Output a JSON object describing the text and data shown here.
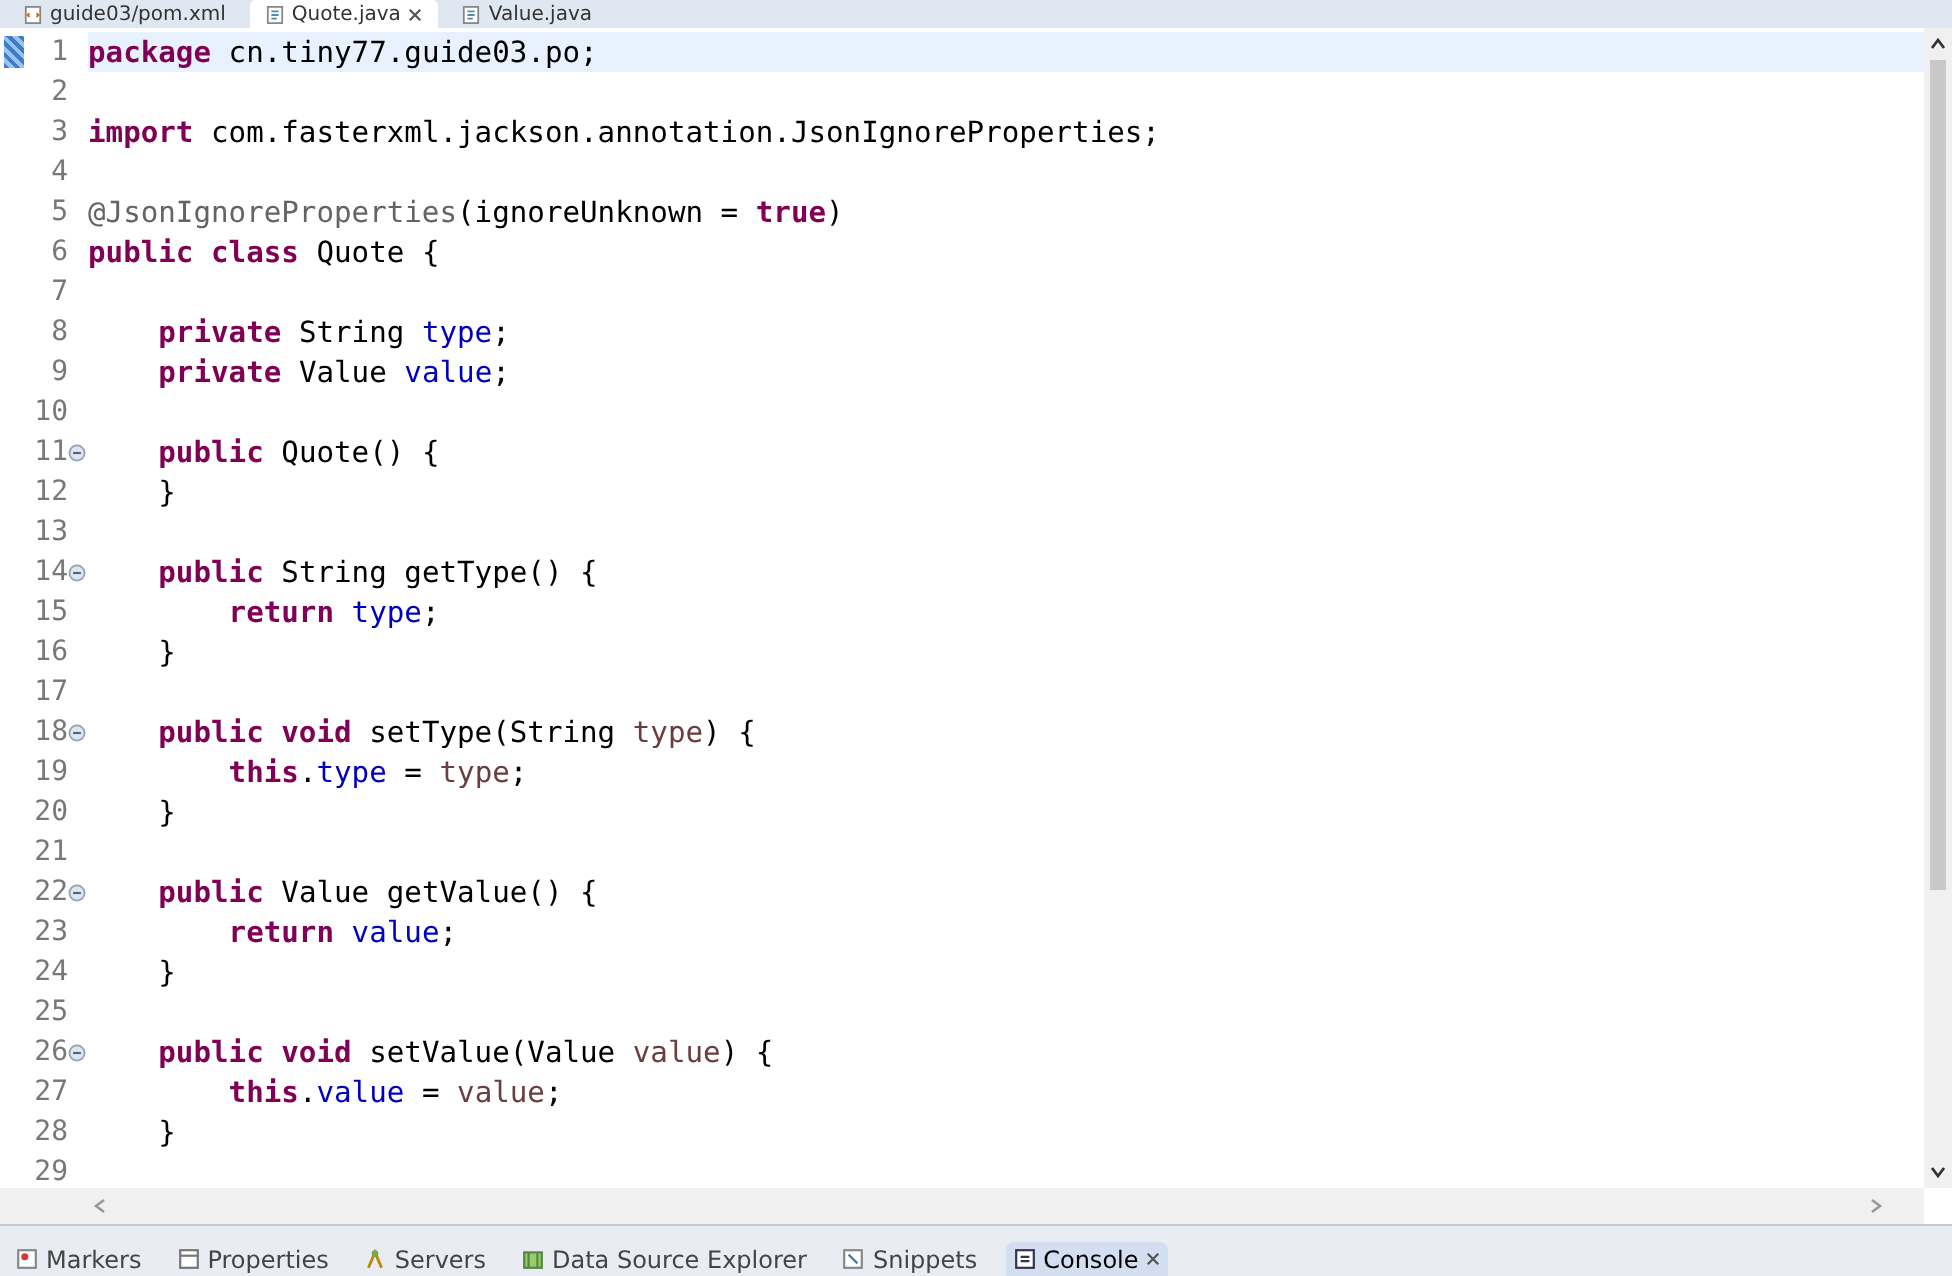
{
  "editor_tabs": [
    {
      "label": "guide03/pom.xml",
      "selected": false
    },
    {
      "label": "Quote.java",
      "selected": true
    },
    {
      "label": "Value.java",
      "selected": false
    }
  ],
  "lines": [
    {
      "number": "1",
      "fold": false,
      "current": true,
      "tokens": [
        {
          "kind": "keyword",
          "text": "package"
        },
        {
          "kind": "plain",
          "text": " cn.tiny77.guide03.po;"
        }
      ]
    },
    {
      "number": "2",
      "fold": false,
      "current": false
    },
    {
      "number": "3",
      "fold": false,
      "current": false,
      "tokens": [
        {
          "kind": "keyword",
          "text": "import"
        },
        {
          "kind": "plain",
          "text": " com.fasterxml.jackson.annotation.JsonIgnoreProperties;"
        }
      ]
    },
    {
      "number": "4",
      "fold": false,
      "current": false
    },
    {
      "number": "5",
      "fold": false,
      "current": false,
      "tokens": [
        {
          "kind": "annotation",
          "text": "@JsonIgnoreProperties"
        },
        {
          "kind": "plain",
          "text": "(ignoreUnknown = "
        },
        {
          "kind": "keyword",
          "text": "true"
        },
        {
          "kind": "plain",
          "text": ")"
        }
      ]
    },
    {
      "number": "6",
      "fold": false,
      "current": false,
      "tokens": [
        {
          "kind": "keyword",
          "text": "public class"
        },
        {
          "kind": "plain",
          "text": " Quote {"
        }
      ]
    },
    {
      "number": "7",
      "fold": false,
      "current": false
    },
    {
      "number": "8",
      "fold": false,
      "current": false,
      "tokens": [
        {
          "kind": "keyword",
          "text": "    private"
        },
        {
          "kind": "plain",
          "text": " String "
        },
        {
          "kind": "field",
          "text": "type"
        },
        {
          "kind": "plain",
          "text": ";"
        }
      ]
    },
    {
      "number": "9",
      "fold": false,
      "current": false,
      "tokens": [
        {
          "kind": "keyword",
          "text": "    private"
        },
        {
          "kind": "plain",
          "text": " Value "
        },
        {
          "kind": "field",
          "text": "value"
        },
        {
          "kind": "plain",
          "text": ";"
        }
      ]
    },
    {
      "number": "10",
      "fold": false,
      "current": false
    },
    {
      "number": "11",
      "fold": true,
      "current": false,
      "tokens": [
        {
          "kind": "keyword",
          "text": "    public"
        },
        {
          "kind": "plain",
          "text": " Quote() {"
        }
      ]
    },
    {
      "number": "12",
      "fold": false,
      "current": false,
      "tokens": [
        {
          "kind": "plain",
          "text": "    }"
        }
      ]
    },
    {
      "number": "13",
      "fold": false,
      "current": false
    },
    {
      "number": "14",
      "fold": true,
      "current": false,
      "tokens": [
        {
          "kind": "keyword",
          "text": "    public"
        },
        {
          "kind": "plain",
          "text": " String getType() {"
        }
      ]
    },
    {
      "number": "15",
      "fold": false,
      "current": false,
      "tokens": [
        {
          "kind": "keyword",
          "text": "        return "
        },
        {
          "kind": "field",
          "text": "type"
        },
        {
          "kind": "plain",
          "text": ";"
        }
      ]
    },
    {
      "number": "16",
      "fold": false,
      "current": false,
      "tokens": [
        {
          "kind": "plain",
          "text": "    }"
        }
      ]
    },
    {
      "number": "17",
      "fold": false,
      "current": false
    },
    {
      "number": "18",
      "fold": true,
      "current": false,
      "tokens": [
        {
          "kind": "keyword",
          "text": "    public void"
        },
        {
          "kind": "plain",
          "text": " setType(String "
        },
        {
          "kind": "parameter",
          "text": "type"
        },
        {
          "kind": "plain",
          "text": ") {"
        }
      ]
    },
    {
      "number": "19",
      "fold": false,
      "current": false,
      "tokens": [
        {
          "kind": "keyword",
          "text": "        this"
        },
        {
          "kind": "plain",
          "text": "."
        },
        {
          "kind": "field",
          "text": "type"
        },
        {
          "kind": "plain",
          "text": " = "
        },
        {
          "kind": "parameter",
          "text": "type"
        },
        {
          "kind": "plain",
          "text": ";"
        }
      ]
    },
    {
      "number": "20",
      "fold": false,
      "current": false,
      "tokens": [
        {
          "kind": "plain",
          "text": "    }"
        }
      ]
    },
    {
      "number": "21",
      "fold": false,
      "current": false
    },
    {
      "number": "22",
      "fold": true,
      "current": false,
      "tokens": [
        {
          "kind": "keyword",
          "text": "    public"
        },
        {
          "kind": "plain",
          "text": " Value getValue() {"
        }
      ]
    },
    {
      "number": "23",
      "fold": false,
      "current": false,
      "tokens": [
        {
          "kind": "keyword",
          "text": "        return "
        },
        {
          "kind": "field",
          "text": "value"
        },
        {
          "kind": "plain",
          "text": ";"
        }
      ]
    },
    {
      "number": "24",
      "fold": false,
      "current": false,
      "tokens": [
        {
          "kind": "plain",
          "text": "    }"
        }
      ]
    },
    {
      "number": "25",
      "fold": false,
      "current": false
    },
    {
      "number": "26",
      "fold": true,
      "current": false,
      "tokens": [
        {
          "kind": "keyword",
          "text": "    public void"
        },
        {
          "kind": "plain",
          "text": " setValue(Value "
        },
        {
          "kind": "parameter",
          "text": "value"
        },
        {
          "kind": "plain",
          "text": ") {"
        }
      ]
    },
    {
      "number": "27",
      "fold": false,
      "current": false,
      "tokens": [
        {
          "kind": "keyword",
          "text": "        this"
        },
        {
          "kind": "plain",
          "text": "."
        },
        {
          "kind": "field",
          "text": "value"
        },
        {
          "kind": "plain",
          "text": " = "
        },
        {
          "kind": "parameter",
          "text": "value"
        },
        {
          "kind": "plain",
          "text": ";"
        }
      ]
    },
    {
      "number": "28",
      "fold": false,
      "current": false,
      "tokens": [
        {
          "kind": "plain",
          "text": "    }"
        }
      ]
    },
    {
      "number": "29",
      "fold": false,
      "current": false
    }
  ],
  "bottom_tabs": [
    {
      "label": "Markers",
      "selected": false
    },
    {
      "label": "Properties",
      "selected": false
    },
    {
      "label": "Servers",
      "selected": false
    },
    {
      "label": "Data Source Explorer",
      "selected": false
    },
    {
      "label": "Snippets",
      "selected": false
    },
    {
      "label": "Console",
      "selected": true
    }
  ]
}
